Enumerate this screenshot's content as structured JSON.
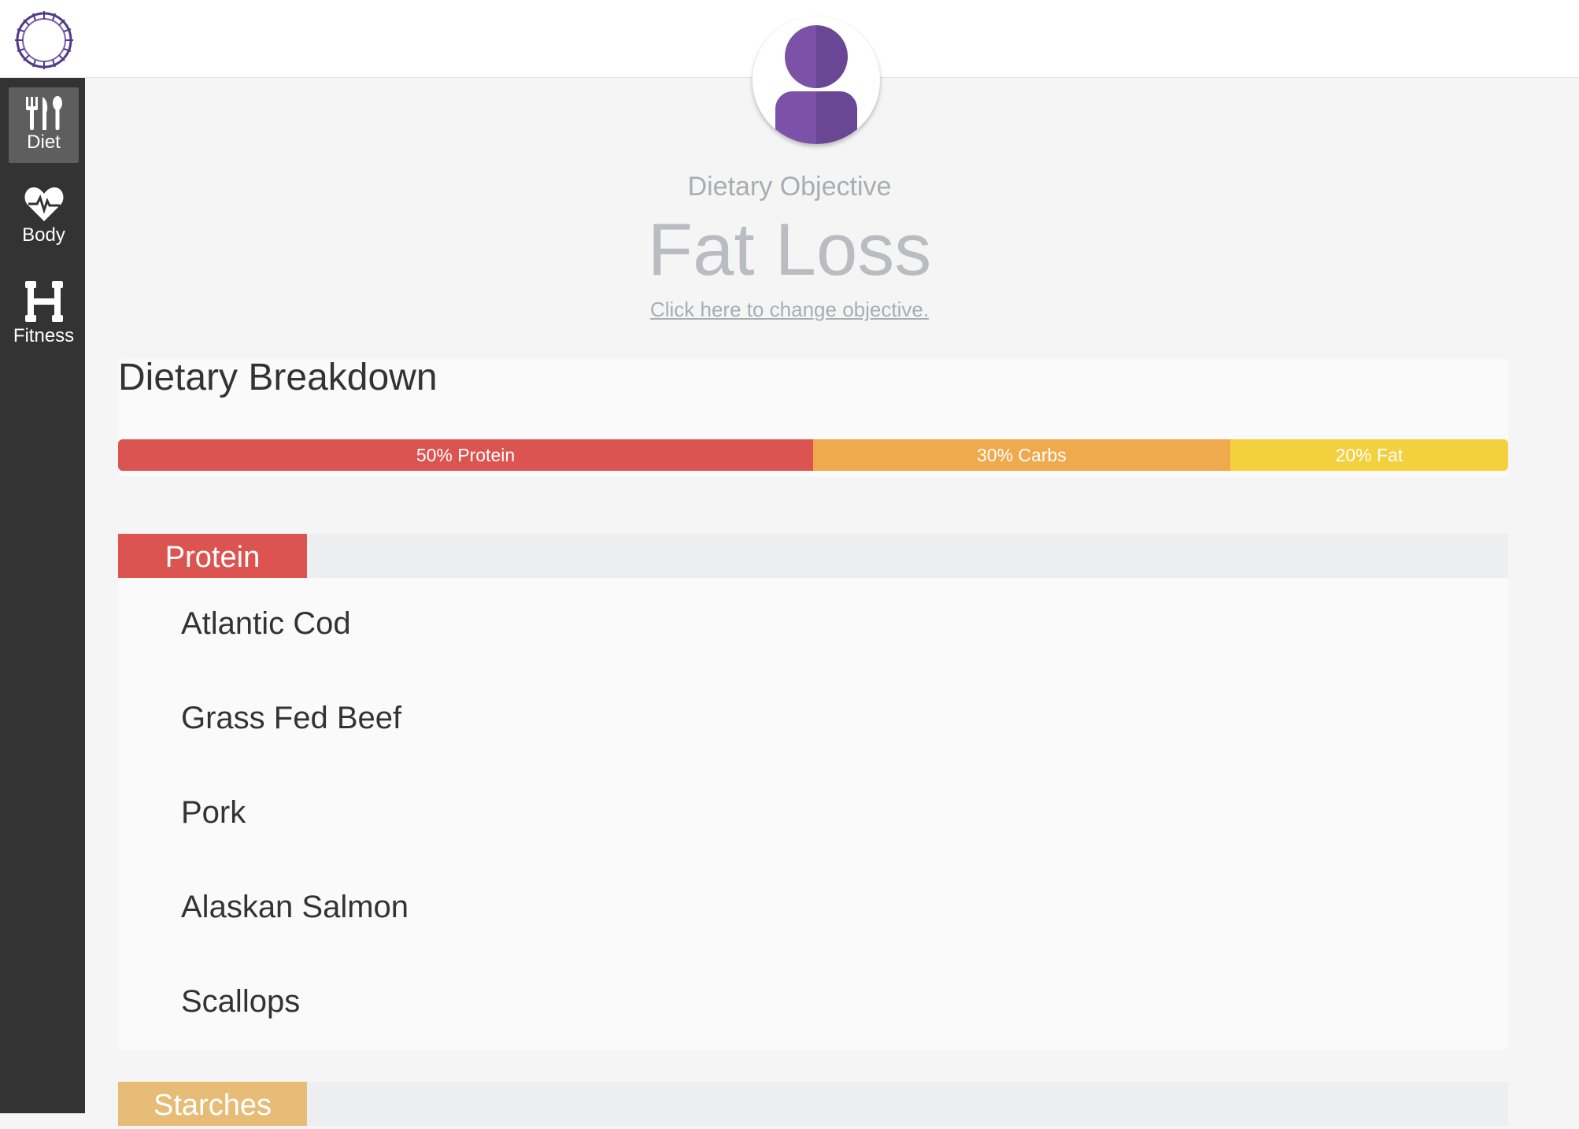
{
  "app": {
    "logo_icon": "dna-ring-logo-icon"
  },
  "sidebar": {
    "items": [
      {
        "label": "Diet",
        "icon": "fork-knife-spoon-icon",
        "active": true
      },
      {
        "label": "Body",
        "icon": "heart-pulse-icon",
        "active": false
      },
      {
        "label": "Fitness",
        "icon": "dumbbell-icon",
        "active": false
      }
    ]
  },
  "objective": {
    "subtitle": "Dietary Objective",
    "title": "Fat Loss",
    "change_link": "Click here to change objective."
  },
  "breakdown": {
    "title": "Dietary Breakdown",
    "segments": [
      {
        "label": "50% Protein",
        "percent": 50,
        "color": "#dc5450"
      },
      {
        "label": "30% Carbs",
        "percent": 30,
        "color": "#f0aa4e"
      },
      {
        "label": "20% Fat",
        "percent": 20,
        "color": "#f3d03e"
      }
    ]
  },
  "sections": [
    {
      "name": "Protein",
      "color": "#dc5450",
      "items": [
        "Atlantic Cod",
        "Grass Fed Beef",
        "Pork",
        "Alaskan Salmon",
        "Scallops"
      ]
    },
    {
      "name": "Starches",
      "color": "#e6bc77",
      "items": []
    }
  ],
  "colors": {
    "sidebar_bg": "#333333",
    "avatar_purple": "#7b52a8",
    "avatar_purple_dark": "#6a4795"
  }
}
